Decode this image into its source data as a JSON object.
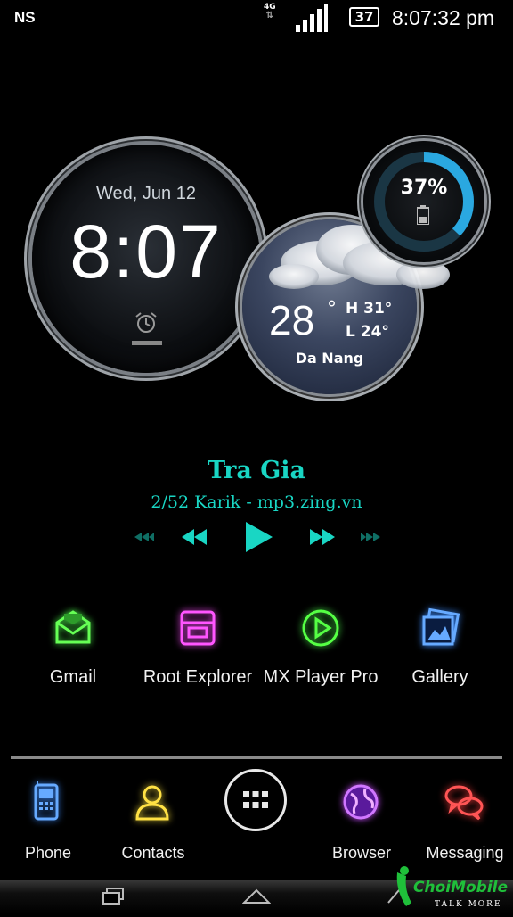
{
  "status_bar": {
    "carrier": "NS",
    "network_type": "4G",
    "battery_level": "37",
    "time": "8:07:32 pm"
  },
  "clock_widget": {
    "date": "Wed, Jun 12",
    "time": "8:07"
  },
  "weather_widget": {
    "temperature": "28",
    "degree_symbol": "°",
    "high": "H 31°",
    "low": "L 24°",
    "city": "Da Nang"
  },
  "battery_widget": {
    "percent_label": "37%",
    "level": 0.37
  },
  "music_player": {
    "title": "Tra Gia",
    "info": "2/52  Karik - mp3.zing.vn"
  },
  "apps": [
    {
      "label": "Gmail",
      "icon": "gmail-icon"
    },
    {
      "label": "Root Explorer",
      "icon": "root-explorer-icon"
    },
    {
      "label": "MX Player Pro",
      "icon": "mx-player-icon"
    },
    {
      "label": "Gallery",
      "icon": "gallery-icon"
    }
  ],
  "dock": [
    {
      "label": "Phone",
      "icon": "phone-icon"
    },
    {
      "label": "Contacts",
      "icon": "contacts-icon"
    },
    {
      "label": "Browser",
      "icon": "browser-icon"
    },
    {
      "label": "Messaging",
      "icon": "messaging-icon"
    }
  ],
  "watermark": {
    "brand": "ChoiMobile",
    "tagline": "TALK MORE"
  },
  "colors": {
    "accent": "#19d6c4",
    "battery_ring": "#2aa8e0"
  }
}
